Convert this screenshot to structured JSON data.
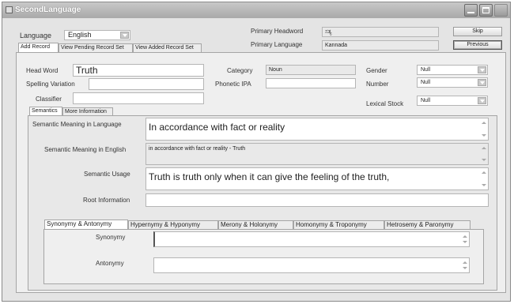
{
  "window": {
    "title": "SecondLanguage"
  },
  "header": {
    "language_label": "Language",
    "language_value": "English",
    "primary_headword_label": "Primary Headword",
    "primary_headword_value": "ಸತ್ಯ",
    "primary_language_label": "Primary Language",
    "primary_language_value": "Kannada",
    "skip_label": "Skip",
    "previous_label": "Previous"
  },
  "top_tabs": [
    "Add Record",
    "View Pending Record Set",
    "View Added Record Set"
  ],
  "form": {
    "head_word_label": "Head Word",
    "head_word_value": "Truth",
    "spelling_variation_label": "Spelling Variation",
    "spelling_variation_value": "",
    "classifier_label": "Classifier",
    "classifier_value": "",
    "category_label": "Category",
    "category_value": "Noun",
    "phonetic_ipa_label": "Phonetic IPA",
    "phonetic_ipa_value": "",
    "gender_label": "Gender",
    "gender_value": "Null",
    "number_label": "Number",
    "number_value": "Null",
    "lexical_stock_label": "Lexical Stock",
    "lexical_stock_value": "Null"
  },
  "inner_tabs": [
    "Semantics",
    "More Information"
  ],
  "semantics": {
    "meaning_language_label": "Semantic Meaning in Language",
    "meaning_language_value": "In accordance with fact or reality",
    "meaning_english_label": "Semantic Meaning in English",
    "meaning_english_value": "in accordance with fact or reality - Truth",
    "usage_label": "Semantic Usage",
    "usage_value": "Truth is truth only when it can give the feeling of the truth,",
    "root_label": "Root Information",
    "root_value": ""
  },
  "relation_tabs": [
    "Synonymy & Antonymy",
    "Hypernymy & Hyponymy",
    "Merony & Holonymy",
    "Homonymy & Troponymy",
    "Hetrosemy & Paronymy"
  ],
  "relations": {
    "synonymy_label": "Synonymy",
    "synonymy_value": "",
    "antonymy_label": "Antonymy",
    "antonymy_value": ""
  }
}
